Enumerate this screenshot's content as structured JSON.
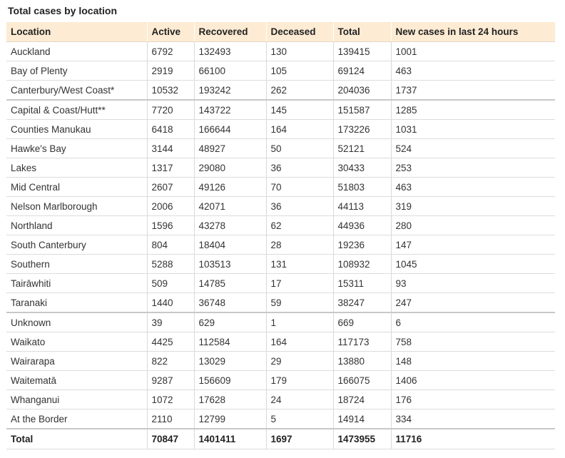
{
  "title": "Total cases by location",
  "columns": [
    "Location",
    "Active",
    "Recovered",
    "Deceased",
    "Total",
    "New cases in last 24 hours"
  ],
  "rows": [
    {
      "location": "Auckland",
      "active": "6792",
      "recovered": "132493",
      "deceased": "130",
      "total": "139415",
      "new": "1001"
    },
    {
      "location": "Bay of Plenty",
      "active": "2919",
      "recovered": "66100",
      "deceased": "105",
      "total": "69124",
      "new": "463"
    },
    {
      "location": "Canterbury/West Coast*",
      "active": "10532",
      "recovered": "193242",
      "deceased": "262",
      "total": "204036",
      "new": "1737"
    },
    {
      "location": "Capital & Coast/Hutt**",
      "active": "7720",
      "recovered": "143722",
      "deceased": "145",
      "total": "151587",
      "new": "1285"
    },
    {
      "location": "Counties Manukau",
      "active": "6418",
      "recovered": "166644",
      "deceased": "164",
      "total": "173226",
      "new": "1031"
    },
    {
      "location": "Hawke's Bay",
      "active": "3144",
      "recovered": "48927",
      "deceased": "50",
      "total": "52121",
      "new": "524"
    },
    {
      "location": "Lakes",
      "active": "1317",
      "recovered": "29080",
      "deceased": "36",
      "total": "30433",
      "new": "253"
    },
    {
      "location": "Mid Central",
      "active": "2607",
      "recovered": "49126",
      "deceased": "70",
      "total": "51803",
      "new": "463"
    },
    {
      "location": "Nelson Marlborough",
      "active": "2006",
      "recovered": "42071",
      "deceased": "36",
      "total": "44113",
      "new": "319"
    },
    {
      "location": "Northland",
      "active": "1596",
      "recovered": "43278",
      "deceased": "62",
      "total": "44936",
      "new": "280"
    },
    {
      "location": "South Canterbury",
      "active": "804",
      "recovered": "18404",
      "deceased": "28",
      "total": "19236",
      "new": "147"
    },
    {
      "location": "Southern",
      "active": "5288",
      "recovered": "103513",
      "deceased": "131",
      "total": "108932",
      "new": "1045"
    },
    {
      "location": "Tairāwhiti",
      "active": "509",
      "recovered": "14785",
      "deceased": "17",
      "total": "15311",
      "new": "93"
    },
    {
      "location": "Taranaki",
      "active": "1440",
      "recovered": "36748",
      "deceased": "59",
      "total": "38247",
      "new": "247"
    },
    {
      "location": "Unknown",
      "active": "39",
      "recovered": "629",
      "deceased": "1",
      "total": "669",
      "new": "6"
    },
    {
      "location": "Waikato",
      "active": "4425",
      "recovered": "112584",
      "deceased": "164",
      "total": "117173",
      "new": "758"
    },
    {
      "location": "Wairarapa",
      "active": "822",
      "recovered": "13029",
      "deceased": "29",
      "total": "13880",
      "new": "148"
    },
    {
      "location": "Waitematā",
      "active": "9287",
      "recovered": "156609",
      "deceased": "179",
      "total": "166075",
      "new": "1406"
    },
    {
      "location": "Whanganui",
      "active": "1072",
      "recovered": "17628",
      "deceased": "24",
      "total": "18724",
      "new": "176"
    },
    {
      "location": "At the Border",
      "active": "2110",
      "recovered": "12799",
      "deceased": "5",
      "total": "14914",
      "new": "334"
    }
  ],
  "totals": {
    "location": "Total",
    "active": "70847",
    "recovered": "1401411",
    "deceased": "1697",
    "total": "1473955",
    "new": "11716"
  }
}
